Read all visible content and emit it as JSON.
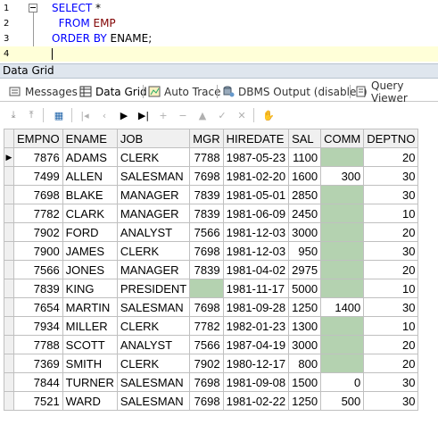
{
  "editor": {
    "lines": [
      {
        "n": "1",
        "parts": [
          {
            "t": "SELECT",
            "c": "kw"
          },
          {
            "t": " *",
            "c": "txt"
          }
        ]
      },
      {
        "n": "2",
        "parts": [
          {
            "t": "  FROM",
            "c": "kw"
          },
          {
            "t": " EMP",
            "c": "tbl"
          }
        ]
      },
      {
        "n": "3",
        "parts": [
          {
            "t": "ORDER BY",
            "c": "kw"
          },
          {
            "t": " ENAME;",
            "c": "txt"
          }
        ]
      },
      {
        "n": "4",
        "parts": [
          {
            "t": "",
            "c": "txt"
          }
        ]
      }
    ]
  },
  "pane_title": "Data Grid",
  "tabs": [
    {
      "label": "Messages",
      "icon": "messages-icon"
    },
    {
      "label": "Data Grid",
      "icon": "grid-icon"
    },
    {
      "label": "Auto Trace",
      "icon": "trace-icon"
    },
    {
      "label": "DBMS Output (disabled)",
      "icon": "dbms-output-icon"
    },
    {
      "label": "Query Viewer",
      "icon": "query-viewer-icon"
    }
  ],
  "toolbar": [
    {
      "icon": "export-icon",
      "glyph": "⤓",
      "on": true
    },
    {
      "icon": "import-icon",
      "glyph": "⤒",
      "on": true
    },
    {
      "icon": "data-grid-options-icon",
      "glyph": "▦",
      "on": true
    },
    {
      "icon": "first-record-icon",
      "glyph": "|◂",
      "on": false
    },
    {
      "icon": "prior-record-icon",
      "glyph": "‹",
      "on": false
    },
    {
      "icon": "next-record-icon",
      "glyph": "▶",
      "on": true
    },
    {
      "icon": "last-record-icon",
      "glyph": "▶|",
      "on": true
    },
    {
      "icon": "insert-record-icon",
      "glyph": "+",
      "on": false
    },
    {
      "icon": "delete-record-icon",
      "glyph": "−",
      "on": false
    },
    {
      "icon": "edit-record-icon",
      "glyph": "▲",
      "on": false
    },
    {
      "icon": "post-edit-icon",
      "glyph": "✓",
      "on": false
    },
    {
      "icon": "cancel-edit-icon",
      "glyph": "✕",
      "on": false
    },
    {
      "icon": "refresh-icon",
      "glyph": "✋",
      "on": false
    }
  ],
  "grid": {
    "columns": [
      "EMPNO",
      "ENAME",
      "JOB",
      "MGR",
      "HIREDATE",
      "SAL",
      "COMM",
      "DEPTNO"
    ],
    "numeric": [
      true,
      false,
      false,
      true,
      false,
      true,
      true,
      true
    ],
    "rows": [
      [
        "7876",
        "ADAMS",
        "CLERK",
        "7788",
        "1987-05-23",
        "1100",
        null,
        "20"
      ],
      [
        "7499",
        "ALLEN",
        "SALESMAN",
        "7698",
        "1981-02-20",
        "1600",
        "300",
        "30"
      ],
      [
        "7698",
        "BLAKE",
        "MANAGER",
        "7839",
        "1981-05-01",
        "2850",
        null,
        "30"
      ],
      [
        "7782",
        "CLARK",
        "MANAGER",
        "7839",
        "1981-06-09",
        "2450",
        null,
        "10"
      ],
      [
        "7902",
        "FORD",
        "ANALYST",
        "7566",
        "1981-12-03",
        "3000",
        null,
        "20"
      ],
      [
        "7900",
        "JAMES",
        "CLERK",
        "7698",
        "1981-12-03",
        "950",
        null,
        "30"
      ],
      [
        "7566",
        "JONES",
        "MANAGER",
        "7839",
        "1981-04-02",
        "2975",
        null,
        "20"
      ],
      [
        "7839",
        "KING",
        "PRESIDENT",
        null,
        "1981-11-17",
        "5000",
        null,
        "10"
      ],
      [
        "7654",
        "MARTIN",
        "SALESMAN",
        "7698",
        "1981-09-28",
        "1250",
        "1400",
        "30"
      ],
      [
        "7934",
        "MILLER",
        "CLERK",
        "7782",
        "1982-01-23",
        "1300",
        null,
        "10"
      ],
      [
        "7788",
        "SCOTT",
        "ANALYST",
        "7566",
        "1987-04-19",
        "3000",
        null,
        "20"
      ],
      [
        "7369",
        "SMITH",
        "CLERK",
        "7902",
        "1980-12-17",
        "800",
        null,
        "20"
      ],
      [
        "7844",
        "TURNER",
        "SALESMAN",
        "7698",
        "1981-09-08",
        "1500",
        "0",
        "30"
      ],
      [
        "7521",
        "WARD",
        "SALESMAN",
        "7698",
        "1981-02-22",
        "1250",
        "500",
        "30"
      ]
    ],
    "current_row": 0,
    "null_color": "#b4d2b0"
  }
}
